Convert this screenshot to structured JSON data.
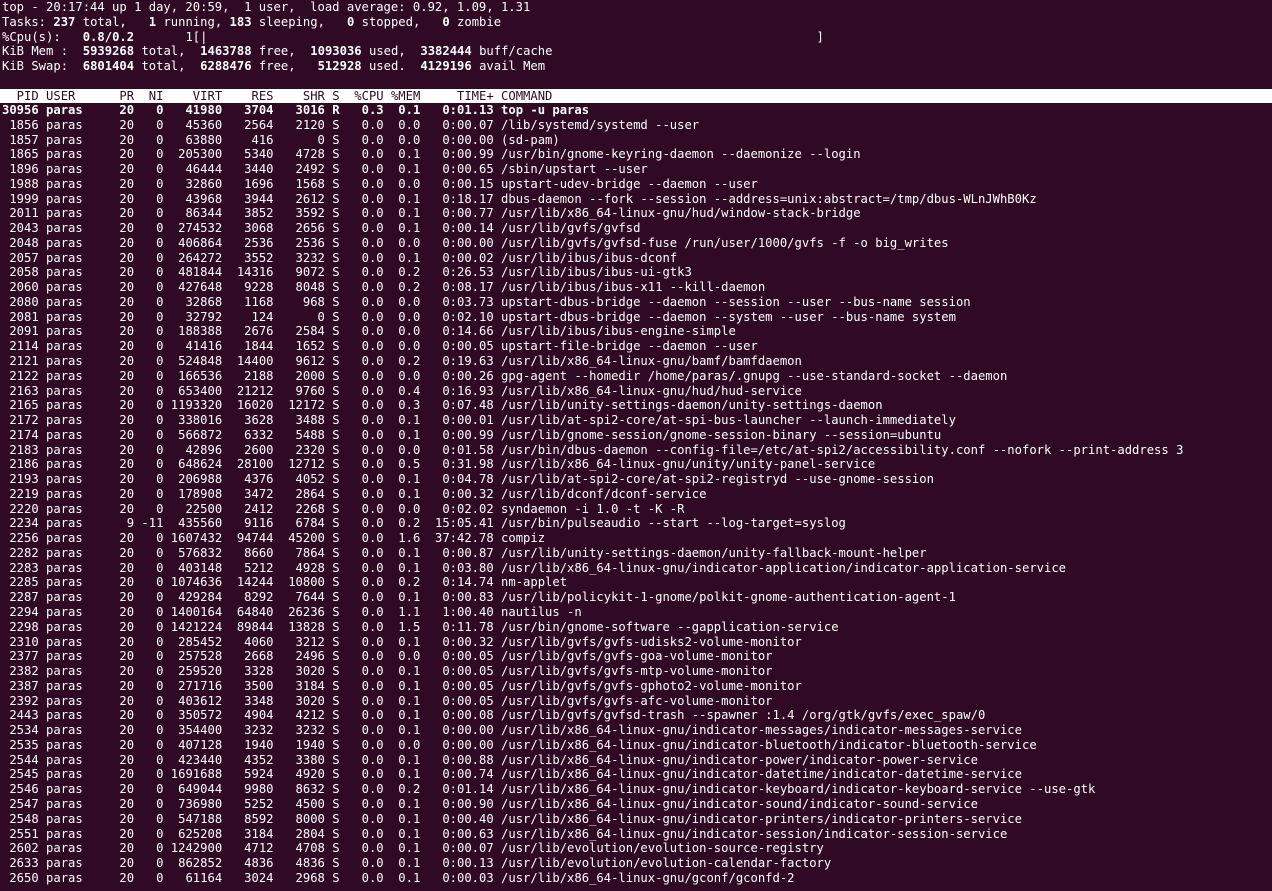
{
  "summary": {
    "line1": {
      "prefix": "top - 20:17:44 up 1 day, 20:59,  1 user,  load average: 0.92, 1.09, 1.31"
    },
    "tasks": {
      "label": "Tasks:",
      "total": "237",
      "total_label": "total,",
      "running": "1",
      "running_label": "running,",
      "sleeping": "183",
      "sleeping_label": "sleeping,",
      "stopped": "0",
      "stopped_label": "stopped,",
      "zombie": "0",
      "zombie_label": "zombie"
    },
    "cpu": {
      "label": "%Cpu(s):",
      "value": "0.8/0.2",
      "bar": "1[|",
      "bar_end": "]"
    },
    "mem": {
      "label": "KiB Mem :",
      "total": "5939268",
      "total_label": "total,",
      "free": "1463788",
      "free_label": "free,",
      "used": "1093036",
      "used_label": "used,",
      "buff": "3382444",
      "buff_label": "buff/cache"
    },
    "swap": {
      "label": "KiB Swap:",
      "total": "6801404",
      "total_label": "total,",
      "free": "6288476",
      "free_label": "free,",
      "used": "512928",
      "used_label": "used.",
      "avail": "4129196",
      "avail_label": "avail Mem"
    }
  },
  "table": {
    "headers": [
      "PID",
      "USER",
      "PR",
      "NI",
      "VIRT",
      "RES",
      "SHR",
      "S",
      "%CPU",
      "%MEM",
      "TIME+",
      "COMMAND"
    ],
    "rows": [
      [
        "30956",
        "paras",
        "20",
        "0",
        "41980",
        "3704",
        "3016",
        "R",
        "0.3",
        "0.1",
        "0:01.13",
        "top -u paras"
      ],
      [
        "1856",
        "paras",
        "20",
        "0",
        "45360",
        "2564",
        "2120",
        "S",
        "0.0",
        "0.0",
        "0:00.07",
        "/lib/systemd/systemd --user"
      ],
      [
        "1857",
        "paras",
        "20",
        "0",
        "63880",
        "416",
        "0",
        "S",
        "0.0",
        "0.0",
        "0:00.00",
        "(sd-pam)"
      ],
      [
        "1865",
        "paras",
        "20",
        "0",
        "205300",
        "5340",
        "4728",
        "S",
        "0.0",
        "0.1",
        "0:00.99",
        "/usr/bin/gnome-keyring-daemon --daemonize --login"
      ],
      [
        "1896",
        "paras",
        "20",
        "0",
        "46444",
        "3440",
        "2492",
        "S",
        "0.0",
        "0.1",
        "0:00.65",
        "/sbin/upstart --user"
      ],
      [
        "1988",
        "paras",
        "20",
        "0",
        "32860",
        "1696",
        "1568",
        "S",
        "0.0",
        "0.0",
        "0:00.15",
        "upstart-udev-bridge --daemon --user"
      ],
      [
        "1999",
        "paras",
        "20",
        "0",
        "43968",
        "3944",
        "2612",
        "S",
        "0.0",
        "0.1",
        "0:18.17",
        "dbus-daemon --fork --session --address=unix:abstract=/tmp/dbus-WLnJWhB0Kz"
      ],
      [
        "2011",
        "paras",
        "20",
        "0",
        "86344",
        "3852",
        "3592",
        "S",
        "0.0",
        "0.1",
        "0:00.77",
        "/usr/lib/x86_64-linux-gnu/hud/window-stack-bridge"
      ],
      [
        "2043",
        "paras",
        "20",
        "0",
        "274532",
        "3068",
        "2656",
        "S",
        "0.0",
        "0.1",
        "0:00.14",
        "/usr/lib/gvfs/gvfsd"
      ],
      [
        "2048",
        "paras",
        "20",
        "0",
        "406864",
        "2536",
        "2536",
        "S",
        "0.0",
        "0.0",
        "0:00.00",
        "/usr/lib/gvfs/gvfsd-fuse /run/user/1000/gvfs -f -o big_writes"
      ],
      [
        "2057",
        "paras",
        "20",
        "0",
        "264272",
        "3552",
        "3232",
        "S",
        "0.0",
        "0.1",
        "0:00.02",
        "/usr/lib/ibus/ibus-dconf"
      ],
      [
        "2058",
        "paras",
        "20",
        "0",
        "481844",
        "14316",
        "9072",
        "S",
        "0.0",
        "0.2",
        "0:26.53",
        "/usr/lib/ibus/ibus-ui-gtk3"
      ],
      [
        "2060",
        "paras",
        "20",
        "0",
        "427648",
        "9228",
        "8048",
        "S",
        "0.0",
        "0.2",
        "0:08.17",
        "/usr/lib/ibus/ibus-x11 --kill-daemon"
      ],
      [
        "2080",
        "paras",
        "20",
        "0",
        "32868",
        "1168",
        "968",
        "S",
        "0.0",
        "0.0",
        "0:03.73",
        "upstart-dbus-bridge --daemon --session --user --bus-name session"
      ],
      [
        "2081",
        "paras",
        "20",
        "0",
        "32792",
        "124",
        "0",
        "S",
        "0.0",
        "0.0",
        "0:02.10",
        "upstart-dbus-bridge --daemon --system --user --bus-name system"
      ],
      [
        "2091",
        "paras",
        "20",
        "0",
        "188388",
        "2676",
        "2584",
        "S",
        "0.0",
        "0.0",
        "0:14.66",
        "/usr/lib/ibus/ibus-engine-simple"
      ],
      [
        "2114",
        "paras",
        "20",
        "0",
        "41416",
        "1844",
        "1652",
        "S",
        "0.0",
        "0.0",
        "0:00.05",
        "upstart-file-bridge --daemon --user"
      ],
      [
        "2121",
        "paras",
        "20",
        "0",
        "524848",
        "14400",
        "9612",
        "S",
        "0.0",
        "0.2",
        "0:19.63",
        "/usr/lib/x86_64-linux-gnu/bamf/bamfdaemon"
      ],
      [
        "2122",
        "paras",
        "20",
        "0",
        "166536",
        "2188",
        "2000",
        "S",
        "0.0",
        "0.0",
        "0:00.26",
        "gpg-agent --homedir /home/paras/.gnupg --use-standard-socket --daemon"
      ],
      [
        "2163",
        "paras",
        "20",
        "0",
        "653400",
        "21212",
        "9760",
        "S",
        "0.0",
        "0.4",
        "0:16.93",
        "/usr/lib/x86_64-linux-gnu/hud/hud-service"
      ],
      [
        "2165",
        "paras",
        "20",
        "0",
        "1193320",
        "16020",
        "12172",
        "S",
        "0.0",
        "0.3",
        "0:07.48",
        "/usr/lib/unity-settings-daemon/unity-settings-daemon"
      ],
      [
        "2172",
        "paras",
        "20",
        "0",
        "338016",
        "3628",
        "3488",
        "S",
        "0.0",
        "0.1",
        "0:00.01",
        "/usr/lib/at-spi2-core/at-spi-bus-launcher --launch-immediately"
      ],
      [
        "2174",
        "paras",
        "20",
        "0",
        "566872",
        "6332",
        "5488",
        "S",
        "0.0",
        "0.1",
        "0:00.99",
        "/usr/lib/gnome-session/gnome-session-binary --session=ubuntu"
      ],
      [
        "2183",
        "paras",
        "20",
        "0",
        "42896",
        "2600",
        "2320",
        "S",
        "0.0",
        "0.0",
        "0:01.58",
        "/usr/bin/dbus-daemon --config-file=/etc/at-spi2/accessibility.conf --nofork --print-address 3"
      ],
      [
        "2186",
        "paras",
        "20",
        "0",
        "648624",
        "28100",
        "12712",
        "S",
        "0.0",
        "0.5",
        "0:31.98",
        "/usr/lib/x86_64-linux-gnu/unity/unity-panel-service"
      ],
      [
        "2193",
        "paras",
        "20",
        "0",
        "206988",
        "4376",
        "4052",
        "S",
        "0.0",
        "0.1",
        "0:04.78",
        "/usr/lib/at-spi2-core/at-spi2-registryd --use-gnome-session"
      ],
      [
        "2219",
        "paras",
        "20",
        "0",
        "178908",
        "3472",
        "2864",
        "S",
        "0.0",
        "0.1",
        "0:00.32",
        "/usr/lib/dconf/dconf-service"
      ],
      [
        "2220",
        "paras",
        "20",
        "0",
        "22500",
        "2412",
        "2268",
        "S",
        "0.0",
        "0.0",
        "0:02.02",
        "syndaemon -i 1.0 -t -K -R"
      ],
      [
        "2234",
        "paras",
        "9",
        "-11",
        "435560",
        "9116",
        "6784",
        "S",
        "0.0",
        "0.2",
        "15:05.41",
        "/usr/bin/pulseaudio --start --log-target=syslog"
      ],
      [
        "2256",
        "paras",
        "20",
        "0",
        "1607432",
        "94744",
        "45200",
        "S",
        "0.0",
        "1.6",
        "37:42.78",
        "compiz"
      ],
      [
        "2282",
        "paras",
        "20",
        "0",
        "576832",
        "8660",
        "7864",
        "S",
        "0.0",
        "0.1",
        "0:00.87",
        "/usr/lib/unity-settings-daemon/unity-fallback-mount-helper"
      ],
      [
        "2283",
        "paras",
        "20",
        "0",
        "403148",
        "5212",
        "4928",
        "S",
        "0.0",
        "0.1",
        "0:03.80",
        "/usr/lib/x86_64-linux-gnu/indicator-application/indicator-application-service"
      ],
      [
        "2285",
        "paras",
        "20",
        "0",
        "1074636",
        "14244",
        "10800",
        "S",
        "0.0",
        "0.2",
        "0:14.74",
        "nm-applet"
      ],
      [
        "2287",
        "paras",
        "20",
        "0",
        "429284",
        "8292",
        "7644",
        "S",
        "0.0",
        "0.1",
        "0:00.83",
        "/usr/lib/policykit-1-gnome/polkit-gnome-authentication-agent-1"
      ],
      [
        "2294",
        "paras",
        "20",
        "0",
        "1400164",
        "64840",
        "26236",
        "S",
        "0.0",
        "1.1",
        "1:00.40",
        "nautilus -n"
      ],
      [
        "2298",
        "paras",
        "20",
        "0",
        "1421224",
        "89844",
        "13828",
        "S",
        "0.0",
        "1.5",
        "0:11.78",
        "/usr/bin/gnome-software --gapplication-service"
      ],
      [
        "2310",
        "paras",
        "20",
        "0",
        "285452",
        "4060",
        "3212",
        "S",
        "0.0",
        "0.1",
        "0:00.32",
        "/usr/lib/gvfs/gvfs-udisks2-volume-monitor"
      ],
      [
        "2377",
        "paras",
        "20",
        "0",
        "257528",
        "2668",
        "2496",
        "S",
        "0.0",
        "0.0",
        "0:00.05",
        "/usr/lib/gvfs/gvfs-goa-volume-monitor"
      ],
      [
        "2382",
        "paras",
        "20",
        "0",
        "259520",
        "3328",
        "3020",
        "S",
        "0.0",
        "0.1",
        "0:00.05",
        "/usr/lib/gvfs/gvfs-mtp-volume-monitor"
      ],
      [
        "2387",
        "paras",
        "20",
        "0",
        "271716",
        "3500",
        "3184",
        "S",
        "0.0",
        "0.1",
        "0:00.05",
        "/usr/lib/gvfs/gvfs-gphoto2-volume-monitor"
      ],
      [
        "2392",
        "paras",
        "20",
        "0",
        "403612",
        "3348",
        "3020",
        "S",
        "0.0",
        "0.1",
        "0:00.05",
        "/usr/lib/gvfs/gvfs-afc-volume-monitor"
      ],
      [
        "2443",
        "paras",
        "20",
        "0",
        "350572",
        "4904",
        "4212",
        "S",
        "0.0",
        "0.1",
        "0:00.08",
        "/usr/lib/gvfs/gvfsd-trash --spawner :1.4 /org/gtk/gvfs/exec_spaw/0"
      ],
      [
        "2534",
        "paras",
        "20",
        "0",
        "354400",
        "3232",
        "3232",
        "S",
        "0.0",
        "0.1",
        "0:00.00",
        "/usr/lib/x86_64-linux-gnu/indicator-messages/indicator-messages-service"
      ],
      [
        "2535",
        "paras",
        "20",
        "0",
        "407128",
        "1940",
        "1940",
        "S",
        "0.0",
        "0.0",
        "0:00.00",
        "/usr/lib/x86_64-linux-gnu/indicator-bluetooth/indicator-bluetooth-service"
      ],
      [
        "2544",
        "paras",
        "20",
        "0",
        "423440",
        "4352",
        "3380",
        "S",
        "0.0",
        "0.1",
        "0:00.88",
        "/usr/lib/x86_64-linux-gnu/indicator-power/indicator-power-service"
      ],
      [
        "2545",
        "paras",
        "20",
        "0",
        "1691688",
        "5924",
        "4920",
        "S",
        "0.0",
        "0.1",
        "0:00.74",
        "/usr/lib/x86_64-linux-gnu/indicator-datetime/indicator-datetime-service"
      ],
      [
        "2546",
        "paras",
        "20",
        "0",
        "649044",
        "9980",
        "8632",
        "S",
        "0.0",
        "0.2",
        "0:01.14",
        "/usr/lib/x86_64-linux-gnu/indicator-keyboard/indicator-keyboard-service --use-gtk"
      ],
      [
        "2547",
        "paras",
        "20",
        "0",
        "736980",
        "5252",
        "4500",
        "S",
        "0.0",
        "0.1",
        "0:00.90",
        "/usr/lib/x86_64-linux-gnu/indicator-sound/indicator-sound-service"
      ],
      [
        "2548",
        "paras",
        "20",
        "0",
        "547188",
        "8592",
        "8000",
        "S",
        "0.0",
        "0.1",
        "0:00.40",
        "/usr/lib/x86_64-linux-gnu/indicator-printers/indicator-printers-service"
      ],
      [
        "2551",
        "paras",
        "20",
        "0",
        "625208",
        "3184",
        "2804",
        "S",
        "0.0",
        "0.1",
        "0:00.63",
        "/usr/lib/x86_64-linux-gnu/indicator-session/indicator-session-service"
      ],
      [
        "2602",
        "paras",
        "20",
        "0",
        "1242900",
        "4712",
        "4708",
        "S",
        "0.0",
        "0.1",
        "0:00.07",
        "/usr/lib/evolution/evolution-source-registry"
      ],
      [
        "2633",
        "paras",
        "20",
        "0",
        "862852",
        "4836",
        "4836",
        "S",
        "0.0",
        "0.1",
        "0:00.13",
        "/usr/lib/evolution/evolution-calendar-factory"
      ],
      [
        "2650",
        "paras",
        "20",
        "0",
        "61164",
        "3024",
        "2968",
        "S",
        "0.0",
        "0.1",
        "0:00.03",
        "/usr/lib/x86_64-linux-gnu/gconf/gconfd-2"
      ]
    ]
  },
  "colors": {
    "background": "#300a24",
    "foreground": "#ffffff",
    "header_background": "#ffffff",
    "header_foreground": "#300a24"
  }
}
